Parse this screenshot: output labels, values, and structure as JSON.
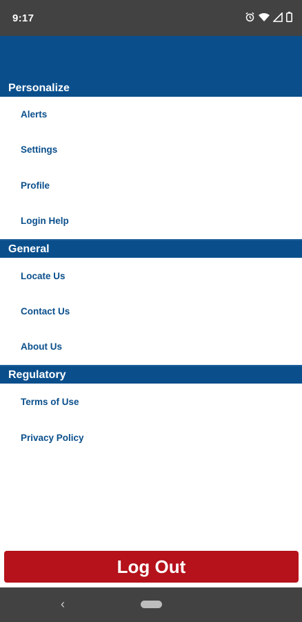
{
  "status": {
    "time": "9:17",
    "icons": [
      "alarm-icon",
      "wifi-icon",
      "signal-icon",
      "battery-icon"
    ]
  },
  "sections": [
    {
      "title": "Personalize",
      "items": [
        "Alerts",
        "Settings",
        "Profile",
        "Login Help"
      ]
    },
    {
      "title": "General",
      "items": [
        "Locate Us",
        "Contact Us",
        "About Us"
      ]
    },
    {
      "title": "Regulatory",
      "items": [
        "Terms of Use",
        "Privacy Policy"
      ]
    }
  ],
  "logout": {
    "label": "Log Out"
  },
  "nav": {
    "back_icon": "back-chevron-icon",
    "home_icon": "home-pill-icon"
  },
  "colors": {
    "brand_blue": "#0a4f8c",
    "logout_red": "#b5121b",
    "system_bar": "#424242"
  }
}
